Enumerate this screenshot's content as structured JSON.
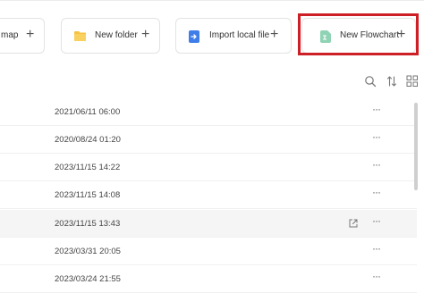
{
  "toolbar": {
    "mindmap_label": "map",
    "new_folder_label": "New folder",
    "import_label": "Import local file",
    "new_flowchart_label": "New Flowchart",
    "plus": "+"
  },
  "list_tools": {
    "search_icon": "search-icon",
    "sort_icon": "sort-icon",
    "view_icon": "grid-view-icon"
  },
  "rows": [
    {
      "date": "2021/06/11 06:00",
      "more": "···"
    },
    {
      "date": "2020/08/24 01:20",
      "more": "···"
    },
    {
      "date": "2023/11/15 14:22",
      "more": "···"
    },
    {
      "date": "2023/11/15 14:08",
      "more": "···"
    },
    {
      "date": "2023/11/15 13:43",
      "more": "···"
    },
    {
      "date": "2023/03/31 20:05",
      "more": "···"
    },
    {
      "date": "2023/03/24 21:55",
      "more": "···"
    }
  ],
  "colors": {
    "highlight": "#cc1f26",
    "folder": "#f6c343",
    "import": "#3f7ee8",
    "flowchart": "#8fd3b4"
  }
}
